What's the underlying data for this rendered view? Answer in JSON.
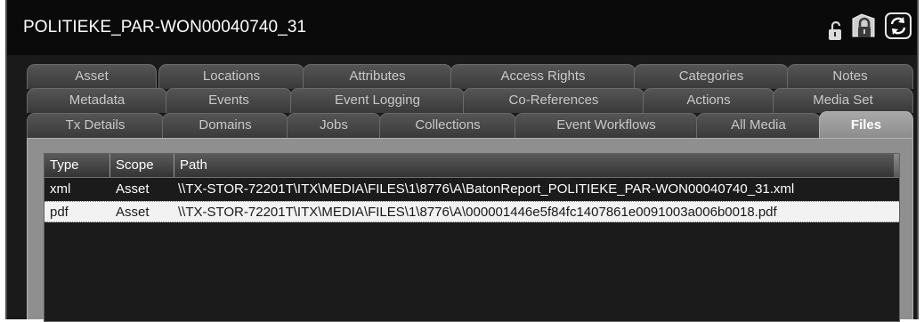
{
  "window": {
    "title": "POLITIEKE_PAR-WON00040740_31"
  },
  "toolbar": {
    "icons": [
      "lock-small-icon",
      "lock-icon",
      "refresh-icon"
    ]
  },
  "tabs": {
    "row1": [
      "Asset",
      "Locations",
      "Attributes",
      "Access Rights",
      "Categories",
      "Notes"
    ],
    "row2": [
      "Metadata",
      "Events",
      "Event Logging",
      "Co-References",
      "Actions",
      "Media Set"
    ],
    "row3": [
      "Tx Details",
      "Domains",
      "Jobs",
      "Collections",
      "Event Workflows",
      "All Media",
      "Files"
    ],
    "active": "Files"
  },
  "files_table": {
    "columns": [
      "Type",
      "Scope",
      "Path"
    ],
    "rows": [
      {
        "type": "xml",
        "scope": "Asset",
        "path": "\\\\TX-STOR-72201T\\ITX\\MEDIA\\FILES\\1\\8776\\A\\BatonReport_POLITIEKE_PAR-WON00040740_31.xml"
      },
      {
        "type": "pdf",
        "scope": "Asset",
        "path": "\\\\TX-STOR-72201T\\ITX\\MEDIA\\FILES\\1\\8776\\A\\000001446e5f84fc1407861e0091003a006b0018.pdf"
      }
    ],
    "selected_row": 1
  },
  "colors": {
    "background": "#1a1a1a",
    "active_tab": "#9a9a9a",
    "selected_row": "#f2f2f2"
  }
}
